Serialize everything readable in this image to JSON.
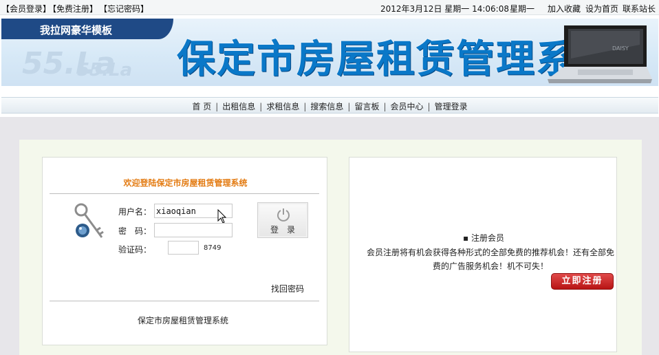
{
  "topbar": {
    "login": "【会员登录】",
    "register": "【免费注册】",
    "forgot": "【忘记密码】",
    "datetime": "2012年3月12日 星期一 14:06:08",
    "weekday": "星期一",
    "add_favorite": "加入收藏",
    "set_home": "设为首页",
    "contact": "联系站长"
  },
  "banner": {
    "brand": "我拉网豪华模板",
    "title": "保定市房屋租赁管理系统",
    "watermark_1": "55.La",
    "watermark_2": "55.La",
    "laptop_brand": "DAISY"
  },
  "nav": {
    "items": [
      "首 页",
      "出租信息",
      "求租信息",
      "搜索信息",
      "留言板",
      "会员中心",
      "管理登录"
    ],
    "separator": "|"
  },
  "login": {
    "welcome": "欢迎登陆保定市房屋租赁管理系统",
    "username_label": "用户名：",
    "username_value": "xiaoqian",
    "password_label": "密　码：",
    "password_value": "",
    "captcha_label": "验证码：",
    "captcha_value": "",
    "captcha_code": "8749",
    "login_button": "登录",
    "find_password": "找回密码",
    "footer": "保定市房屋租赁管理系统"
  },
  "register": {
    "heading": "▪ 注册会员",
    "description": "会员注册将有机会获得各种形式的全部免费的推荐机会！还有全部免费的广告服务机会！机不可失！",
    "button": "立即注册"
  },
  "colors": {
    "title_blue": "#0a78c8",
    "welcome_orange": "#e37b12",
    "register_red": "#c41b1b",
    "brand_stripe": "#1f4a86"
  }
}
